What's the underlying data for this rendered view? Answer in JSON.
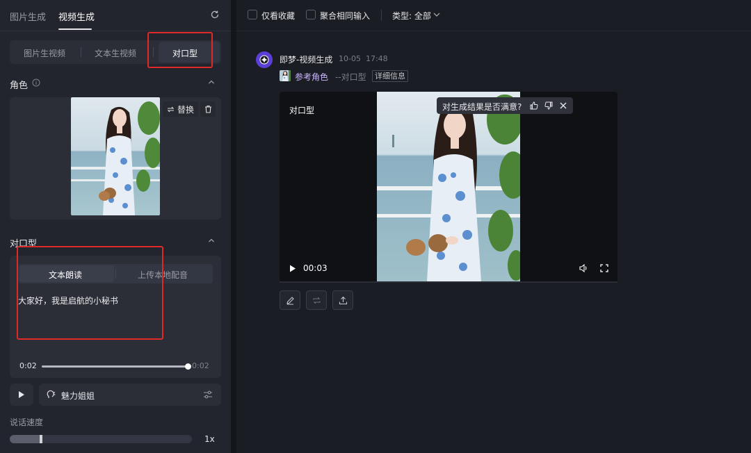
{
  "left": {
    "top_tabs": [
      "图片生成",
      "视频生成"
    ],
    "mode_tabs": [
      "图片生视频",
      "文本生视频",
      "对口型"
    ],
    "character": {
      "title": "角色",
      "replace_label": "替换"
    },
    "lipsync": {
      "title": "对口型",
      "tabs": [
        "文本朗读",
        "上传本地配音"
      ],
      "text": "大家好，我是启航的小秘书",
      "time_current": "0:02",
      "time_total": "0:02",
      "progress": 1.0
    },
    "voice": {
      "name": "魅力姐姐"
    },
    "speed": {
      "title": "说话速度",
      "value_label": "1x",
      "fraction": 0.17
    }
  },
  "right": {
    "filters": {
      "favorites_label": "仅看收藏",
      "merge_label": "聚合相同输入",
      "type_label": "类型: 全部"
    },
    "generation": {
      "title": "即梦-视频生成",
      "date": "10-05",
      "time": "17:48",
      "ref_label": "参考角色",
      "mode_label": "--对口型",
      "detail_label": "详细信息"
    },
    "video": {
      "label": "对口型",
      "feedback_text": "对生成结果是否满意?",
      "time": "00:03"
    }
  },
  "colors": {
    "accent_purple": "#5b3fd6",
    "highlight_red": "#e02a2a"
  }
}
